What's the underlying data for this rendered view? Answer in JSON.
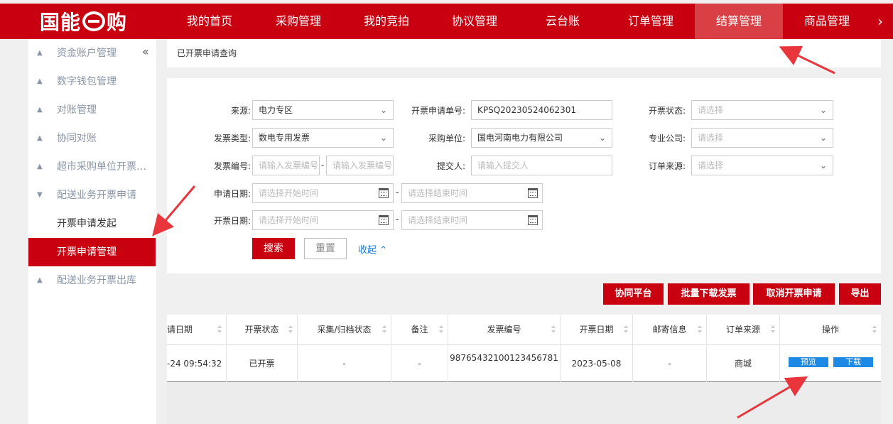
{
  "logo": {
    "text_a": "国能",
    "text_b": "购"
  },
  "nav": {
    "items": [
      "我的首页",
      "采购管理",
      "我的竞拍",
      "协议管理",
      "云台账",
      "订单管理",
      "结算管理",
      "商品管理"
    ],
    "active_index": 6,
    "more_icon": "chevron-right-icon"
  },
  "sidebar": {
    "collapse_icon": "double-chevron-left-icon",
    "items": [
      "资金账户管理",
      "数字钱包管理",
      "对账管理",
      "协同对账",
      "超市采购单位开票…",
      "配送业务开票申请"
    ],
    "sub_items": [
      "开票申请发起",
      "开票申请管理"
    ],
    "active_sub_index": 1,
    "last_item": "配送业务开票出库"
  },
  "breadcrumb": "已开票申请查询",
  "filter": {
    "source_label": "来源:",
    "source_value": "电力专区",
    "apply_no_label": "开票申请单号:",
    "apply_no_value": "KPSQ20230524062301",
    "status_label": "开票状态:",
    "status_placeholder": "请选择",
    "invoice_type_label": "发票类型:",
    "invoice_type_value": "数电专用发票",
    "purchaser_label": "采购单位:",
    "purchaser_value": "国电河南电力有限公司",
    "company_label": "专业公司:",
    "company_placeholder": "请选择",
    "invoice_no_label": "发票编号:",
    "invoice_no_placeholder": "请输入发票编号",
    "submitter_label": "提交人:",
    "submitter_placeholder": "请输入提交人",
    "order_source_label": "订单来源:",
    "order_source_placeholder": "请选择",
    "apply_date_label": "申请日期:",
    "invoice_date_label": "开票日期:",
    "start_placeholder": "请选择开始时间",
    "end_placeholder": "请选择结束时间",
    "dash": "-",
    "search_label": "搜索",
    "reset_label": "重置",
    "collapse_label": "收起"
  },
  "actions": [
    "协同平台",
    "批量下载发票",
    "取消开票申请",
    "导出"
  ],
  "table": {
    "headers": [
      "请日期",
      "开票状态",
      "采集/归档状态",
      "备注",
      "发票编号",
      "开票日期",
      "邮寄信息",
      "订单来源",
      "操作"
    ],
    "rows": [
      {
        "date": "-24 09:54:32",
        "status": "已开票",
        "archive": "-",
        "remark": "-",
        "invoice_no": "98765432100123456781",
        "invoice_date": "2023-05-08",
        "mail": "-",
        "order_source": "商城",
        "preview": "预览",
        "download": "下载"
      }
    ]
  },
  "colors": {
    "brand": "#c8000f",
    "nav_active": "#d84046",
    "link": "#1e7bd6",
    "op_button": "#1e88e5",
    "arrow": "#e8363c"
  }
}
